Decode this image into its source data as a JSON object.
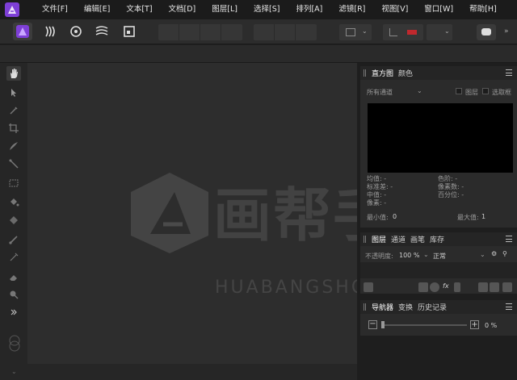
{
  "menu": {
    "items": [
      "文件[F]",
      "编辑[E]",
      "文本[T]",
      "文档[D]",
      "图层[L]",
      "选择[S]",
      "排列[A]",
      "滤镜[R]",
      "视图[V]",
      "窗口[W]",
      "帮助[H]"
    ]
  },
  "toolbar": {
    "more": "»"
  },
  "watermark": {
    "main": "画帮手",
    "sub": "HUABANGSHOU.COM"
  },
  "histogram_panel": {
    "tabs": [
      "直方图",
      "颜色"
    ],
    "channel_select": "所有通道",
    "checkbox_layer": "图层",
    "checkbox_marquee": "选取框",
    "stats_left": [
      "均值: -",
      "标准差: -",
      "中值: -",
      "像素: -"
    ],
    "stats_right": [
      "色阶: -",
      "像素数: -",
      "百分位: -"
    ],
    "min_label": "最小值:",
    "min_value": "0",
    "max_label": "最大值:",
    "max_value": "1"
  },
  "layers_panel": {
    "tabs": [
      "图层",
      "通道",
      "画笔",
      "库存"
    ],
    "opacity_label": "不透明度:",
    "opacity_value": "100 %",
    "blend_mode": "正常",
    "fx": "fx"
  },
  "navigator_panel": {
    "tabs": [
      "导航器",
      "变换",
      "历史记录"
    ],
    "zoom_value": "0 %"
  },
  "colors": {
    "accent": "#7e3fd6",
    "swatch_red": "#c0282d"
  }
}
